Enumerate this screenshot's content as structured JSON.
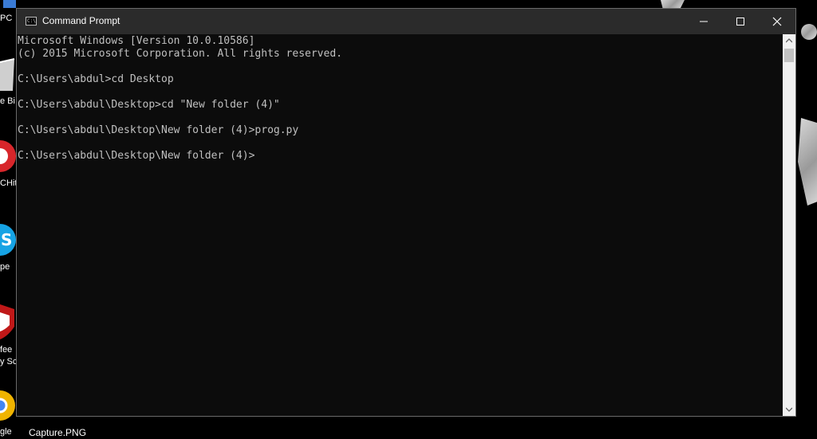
{
  "window": {
    "title": "Command Prompt",
    "minimize_icon": "minimize-icon",
    "maximize_icon": "maximize-icon",
    "close_icon": "close-icon",
    "app_icon_text": "C:\\"
  },
  "console": {
    "lines": [
      "Microsoft Windows [Version 10.0.10586]",
      "(c) 2015 Microsoft Corporation. All rights reserved.",
      "",
      "C:\\Users\\abdul>cd Desktop",
      "",
      "C:\\Users\\abdul\\Desktop>cd \"New folder (4)\"",
      "",
      "C:\\Users\\abdul\\Desktop\\New folder (4)>prog.py",
      "",
      "C:\\Users\\abdul\\Desktop\\New folder (4)>"
    ],
    "text_color": "#c0c0c0",
    "background": "#0c0c0c"
  },
  "desktop": {
    "icons": [
      {
        "label": "PC",
        "icon": "this-pc-icon"
      },
      {
        "label": "e Bi",
        "icon": "recycle-bin-icon"
      },
      {
        "label": "CHit",
        "icon": "app-icon"
      },
      {
        "label": "pe",
        "icon": "skype-icon"
      },
      {
        "label": "fee",
        "icon": "mcafee-icon"
      },
      {
        "label": "y Sc",
        "icon": "mcafee-icon"
      },
      {
        "label": "gle",
        "icon": "chrome-icon"
      },
      {
        "label": "Capture.PNG",
        "icon": "image-file-icon"
      }
    ]
  }
}
